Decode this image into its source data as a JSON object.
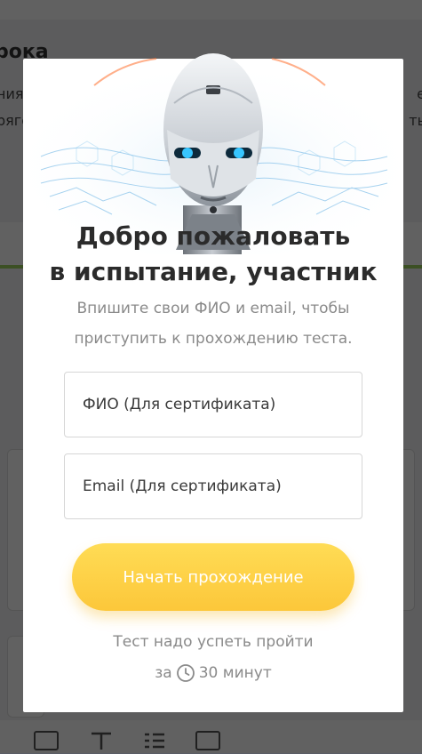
{
  "background": {
    "title_fragment": "рока",
    "line1_fragment": "ния",
    "line2_fragment": "ряго",
    "right1_fragment": "е",
    "right2_fragment": "ть"
  },
  "modal": {
    "title_line1": "Добро пожаловать",
    "title_line2": "в испытание, участник",
    "subtitle_line1": "Впишите свои ФИО и email, чтобы",
    "subtitle_line2": "приступить к прохождению теста.",
    "name_field": {
      "placeholder": "ФИО (Для сертификата)",
      "value": ""
    },
    "email_field": {
      "placeholder": "Email (Для сертификата)",
      "value": ""
    },
    "start_button": "Начать прохождение",
    "time_note_line1": "Тест надо успеть пройти",
    "time_note_prefix": "за",
    "time_note_value": "30 минут"
  },
  "colors": {
    "button_top": "#ffdc55",
    "button_bottom": "#fcc73a",
    "title": "#2b2b2b",
    "muted_text": "#8a8a8a",
    "robot_eyes": "#37c6ff"
  },
  "icons": [
    "clock-icon",
    "image-icon",
    "text-icon",
    "list-icon",
    "video-icon"
  ]
}
